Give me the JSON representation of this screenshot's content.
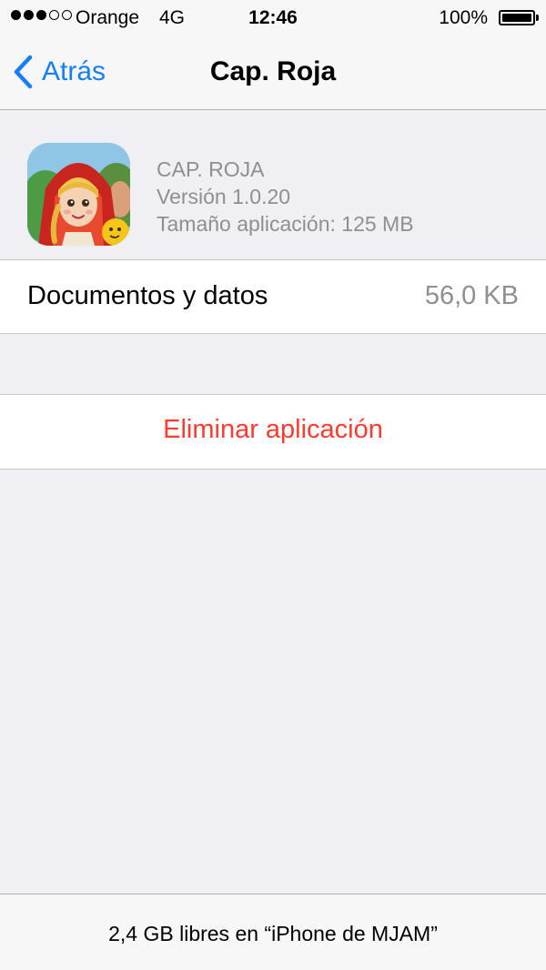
{
  "status_bar": {
    "carrier": "Orange",
    "network": "4G",
    "time": "12:46",
    "battery_percent": "100%",
    "battery_level": 1.0,
    "signal_bars_filled": 3,
    "signal_bars_total": 5
  },
  "nav": {
    "back_label": "Atrás",
    "title": "Cap. Roja",
    "accent_color": "#147efb"
  },
  "app": {
    "name": "CAP. ROJA",
    "version": "Versión 1.0.20",
    "size": "Tamaño aplicación: 125 MB",
    "icon": "app-icon"
  },
  "documents": {
    "label": "Documentos y datos",
    "value": "56,0 KB"
  },
  "delete": {
    "label": "Eliminar aplicación",
    "color": "#ff3b30"
  },
  "footer": {
    "text": "2,4 GB libres en “iPhone de MJAM”"
  }
}
